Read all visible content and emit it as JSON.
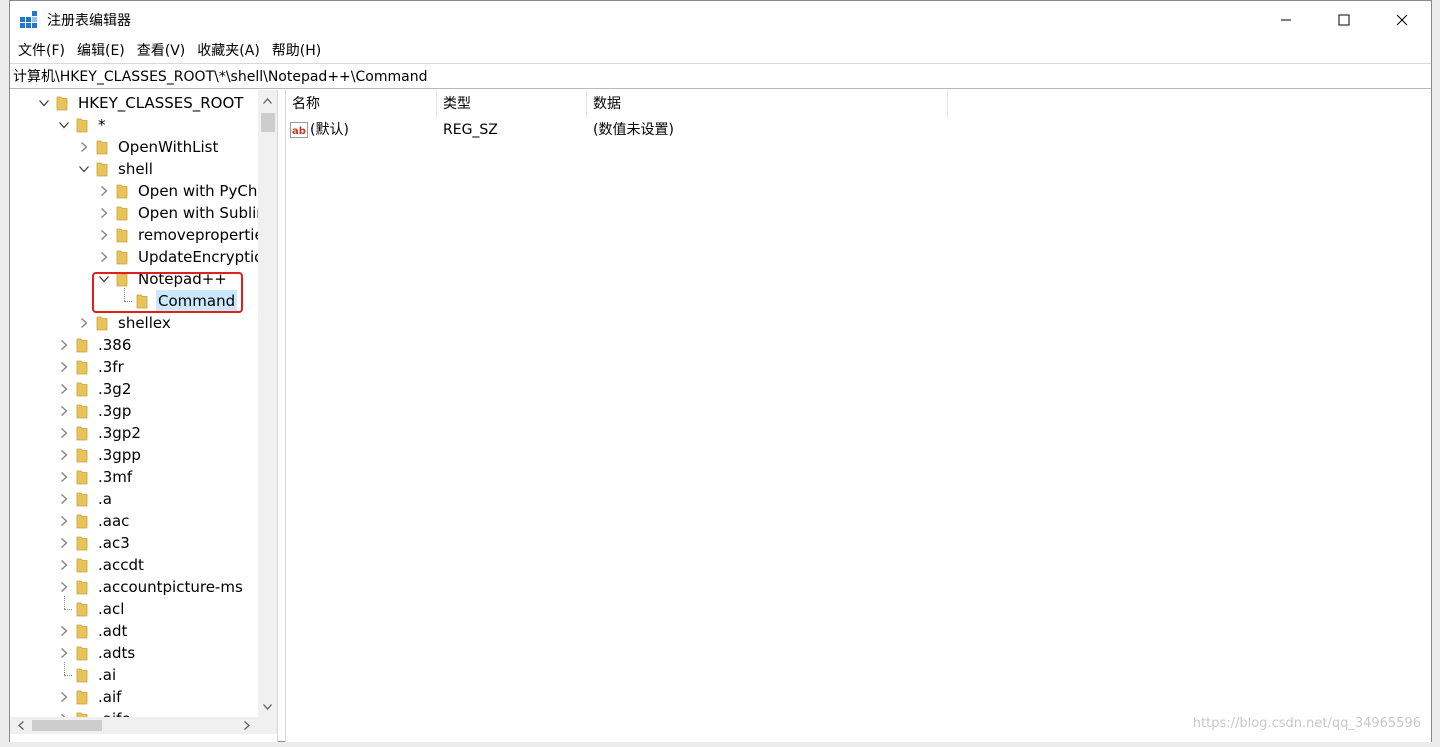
{
  "window": {
    "title": "注册表编辑器",
    "minimize_label": "",
    "maximize_label": "",
    "close_label": ""
  },
  "menu": [
    "文件(F)",
    "编辑(E)",
    "查看(V)",
    "收藏夹(A)",
    "帮助(H)"
  ],
  "address": "计算机\\HKEY_CLASSES_ROOT\\*\\shell\\Notepad++\\Command",
  "tree": [
    {
      "label": "HKEY_CLASSES_ROOT",
      "depth": 0,
      "state": "expanded"
    },
    {
      "label": "*",
      "depth": 1,
      "state": "expanded"
    },
    {
      "label": "OpenWithList",
      "depth": 2,
      "state": "collapsed"
    },
    {
      "label": "shell",
      "depth": 2,
      "state": "expanded"
    },
    {
      "label": "Open with PyCharm",
      "depth": 3,
      "state": "collapsed"
    },
    {
      "label": "Open with Sublime",
      "depth": 3,
      "state": "collapsed"
    },
    {
      "label": "removeproperties",
      "depth": 3,
      "state": "collapsed"
    },
    {
      "label": "UpdateEncryption",
      "depth": 3,
      "state": "collapsed"
    },
    {
      "label": "Notepad++",
      "depth": 3,
      "state": "expanded"
    },
    {
      "label": "Command",
      "depth": 4,
      "state": "leaf",
      "selected": true
    },
    {
      "label": "shellex",
      "depth": 2,
      "state": "collapsed"
    },
    {
      "label": ".386",
      "depth": 1,
      "state": "collapsed"
    },
    {
      "label": ".3fr",
      "depth": 1,
      "state": "collapsed"
    },
    {
      "label": ".3g2",
      "depth": 1,
      "state": "collapsed"
    },
    {
      "label": ".3gp",
      "depth": 1,
      "state": "collapsed"
    },
    {
      "label": ".3gp2",
      "depth": 1,
      "state": "collapsed"
    },
    {
      "label": ".3gpp",
      "depth": 1,
      "state": "collapsed"
    },
    {
      "label": ".3mf",
      "depth": 1,
      "state": "collapsed"
    },
    {
      "label": ".a",
      "depth": 1,
      "state": "collapsed"
    },
    {
      "label": ".aac",
      "depth": 1,
      "state": "collapsed"
    },
    {
      "label": ".ac3",
      "depth": 1,
      "state": "collapsed"
    },
    {
      "label": ".accdt",
      "depth": 1,
      "state": "collapsed"
    },
    {
      "label": ".accountpicture-ms",
      "depth": 1,
      "state": "collapsed"
    },
    {
      "label": ".acl",
      "depth": 1,
      "state": "leaf"
    },
    {
      "label": ".adt",
      "depth": 1,
      "state": "collapsed"
    },
    {
      "label": ".adts",
      "depth": 1,
      "state": "collapsed"
    },
    {
      "label": ".ai",
      "depth": 1,
      "state": "leaf"
    },
    {
      "label": ".aif",
      "depth": 1,
      "state": "collapsed"
    },
    {
      "label": ".aifc",
      "depth": 1,
      "state": "collapsed"
    }
  ],
  "list": {
    "columns": [
      "名称",
      "类型",
      "数据"
    ],
    "rows": [
      {
        "name": "(默认)",
        "type": "REG_SZ",
        "data": "(数值未设置)"
      }
    ]
  },
  "watermark": "https://blog.csdn.net/qq_34965596",
  "colors": {
    "folder": "#e8c35a",
    "selection": "#cce8ff",
    "highlight_box": "#e0201e",
    "app_icon": "#1f77d0"
  }
}
